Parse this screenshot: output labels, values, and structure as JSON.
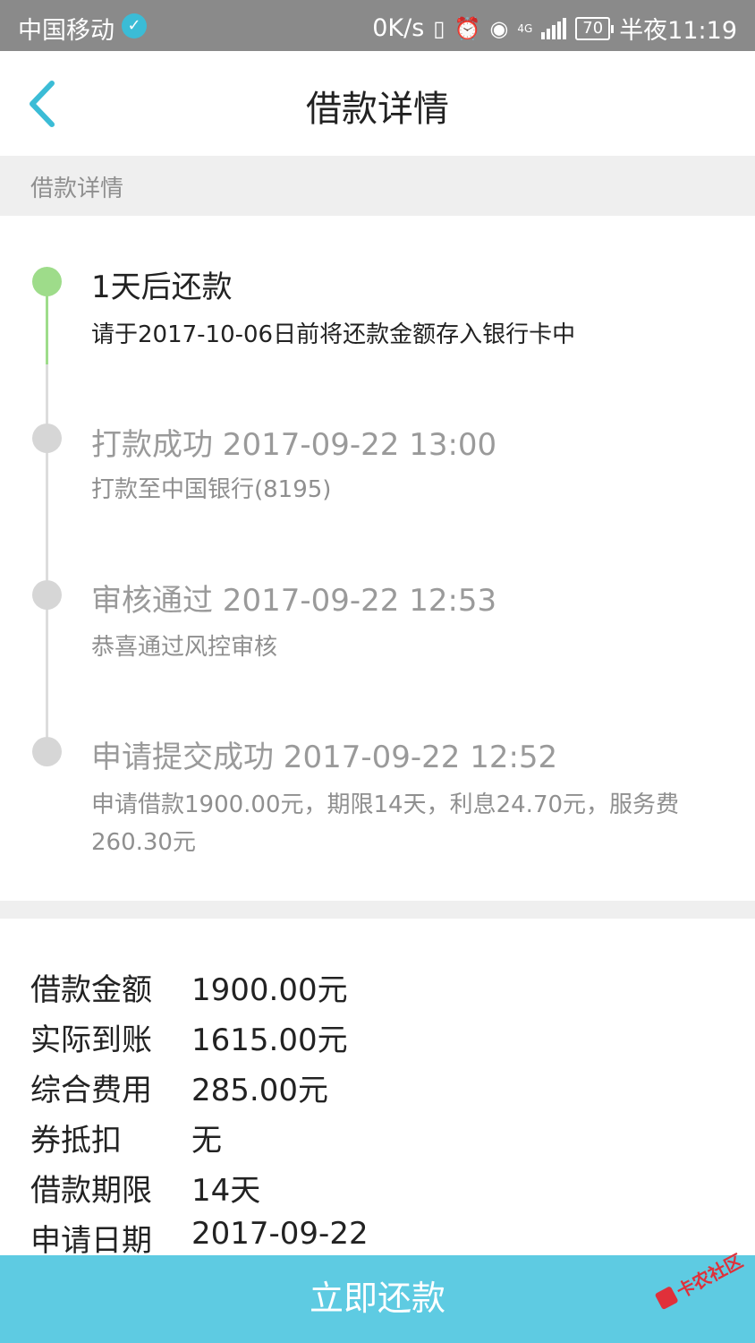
{
  "status_bar": {
    "carrier": "中国移动",
    "speed": "0K/s",
    "network": "4G",
    "battery": "70",
    "time": "半夜11:19"
  },
  "header": {
    "title": "借款详情"
  },
  "section": {
    "label": "借款详情"
  },
  "timeline": [
    {
      "title": "1天后还款",
      "desc": "请于2017-10-06日前将还款金额存入银行卡中",
      "active": true
    },
    {
      "title": "打款成功 2017-09-22 13:00",
      "desc": "打款至中国银行(8195)",
      "active": false
    },
    {
      "title": "审核通过 2017-09-22 12:53",
      "desc": "恭喜通过风控审核",
      "active": false
    },
    {
      "title": "申请提交成功 2017-09-22 12:52",
      "desc": "申请借款1900.00元，期限14天，利息24.70元，服务费260.30元",
      "active": false
    }
  ],
  "details": [
    {
      "label": "借款金额",
      "value": "1900.00元"
    },
    {
      "label": "实际到账",
      "value": "1615.00元"
    },
    {
      "label": "综合费用",
      "value": "285.00元"
    },
    {
      "label": "券抵扣",
      "value": "无"
    },
    {
      "label": "借款期限",
      "value": "14天"
    },
    {
      "label": "申请日期",
      "value": "2017-09-22"
    }
  ],
  "repay_button": "立即还款",
  "watermark": "卡农社区",
  "colors": {
    "accent": "#5ecbe2",
    "active_dot": "#9edc8a",
    "inactive_dot": "#d6d6d6"
  }
}
